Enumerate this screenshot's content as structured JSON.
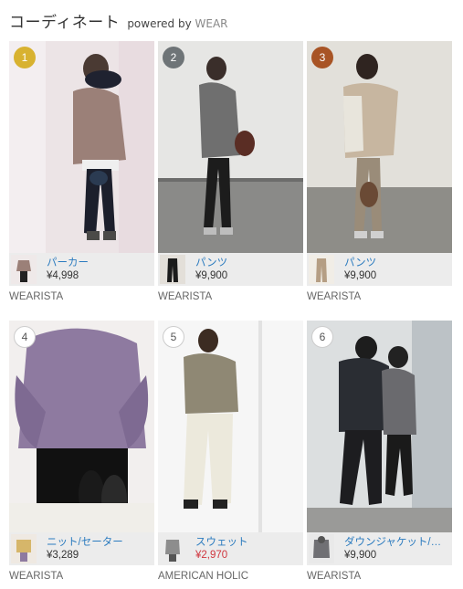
{
  "header": {
    "title": "コーディネート",
    "powered_prefix": "powered by",
    "powered_brand": "WEAR"
  },
  "colors": {
    "gold": "#d8b230",
    "gray_badge": "#6e7477",
    "bronze": "#a85425",
    "link_blue": "#2b7bbf",
    "sale_red": "#d0363f"
  },
  "cards": [
    {
      "rank": "1",
      "category": "パーカー",
      "price": "¥4,998",
      "sale": false,
      "brand": "WEARISTA"
    },
    {
      "rank": "2",
      "category": "パンツ",
      "price": "¥9,900",
      "sale": false,
      "brand": "WEARISTA"
    },
    {
      "rank": "3",
      "category": "パンツ",
      "price": "¥9,900",
      "sale": false,
      "brand": "WEARISTA"
    },
    {
      "rank": "4",
      "category": "ニット/セーター",
      "price": "¥3,289",
      "sale": false,
      "brand": "WEARISTA"
    },
    {
      "rank": "5",
      "category": "スウェット",
      "price": "¥2,970",
      "sale": true,
      "brand": "AMERICAN HOLIC"
    },
    {
      "rank": "6",
      "category": "ダウンジャケット/コート",
      "price": "¥9,900",
      "sale": false,
      "brand": "WEARISTA"
    }
  ]
}
